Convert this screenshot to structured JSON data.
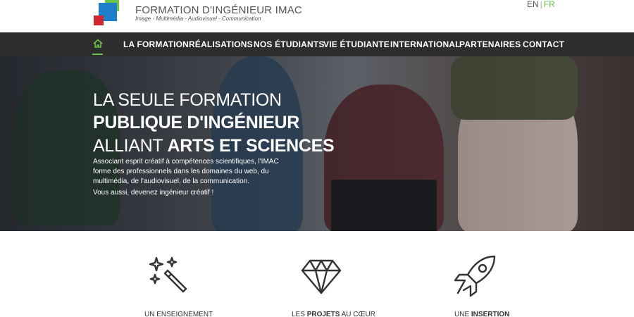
{
  "brand": {
    "title": "Formation d'ingénieur IMAC",
    "subtitle": "Image - Multimédia - Audiovisuel - Communication"
  },
  "lang": {
    "en": "EN",
    "sep": "|",
    "fr": "FR"
  },
  "nav": {
    "items": [
      "La Formation",
      "Réalisations",
      "Nos étudiants",
      "Vie étudiante",
      "International",
      "Partenaires",
      "Contact"
    ]
  },
  "hero": {
    "line1": "La seule formation",
    "line2": "publique d'ingénieur",
    "line3_a": "alliant ",
    "line3_b": "arts et sciences",
    "desc": "Associant esprit créatif à compétences scientifiques, l'IMAC forme des professionnels dans les domaines du web, du multimédia, de l'audiovisuel, de la communication.",
    "cta": "Vous aussi, devenez ingénieur créatif !"
  },
  "features": [
    {
      "icon": "magic-wand-icon",
      "label_a": "Un enseignement",
      "label_b": ""
    },
    {
      "icon": "diamond-icon",
      "label_a": "Les ",
      "label_b": "projets",
      "label_c": " au cœur"
    },
    {
      "icon": "rocket-icon",
      "label_a": "Une ",
      "label_b": "insertion",
      "label_c": ""
    }
  ],
  "colors": {
    "accent": "#6cc24a",
    "nav_bg": "#2d2d2d"
  }
}
